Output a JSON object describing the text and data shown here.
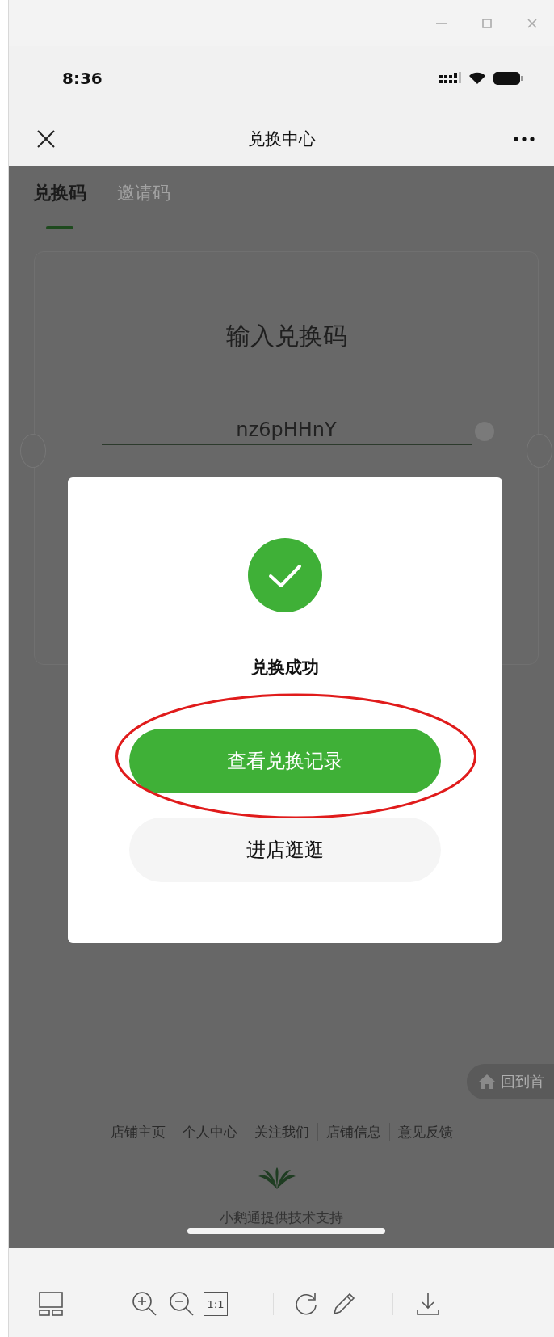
{
  "status_bar": {
    "time": "8:36"
  },
  "nav": {
    "title": "兑换中心"
  },
  "tabs": [
    {
      "label": "兑换码",
      "selected": true
    },
    {
      "label": "邀请码",
      "selected": false
    }
  ],
  "card": {
    "title": "输入兑换码",
    "code": "nz6pHHnY"
  },
  "dialog": {
    "message": "兑换成功",
    "buttons": [
      {
        "label": "查看兑换记录",
        "kind": "primary",
        "highlighted": true
      },
      {
        "label": "进店逛逛",
        "kind": "secondary",
        "highlighted": false
      }
    ]
  },
  "home_button": {
    "label": "回到首"
  },
  "footer_links": [
    "店铺主页",
    "个人中心",
    "关注我们",
    "店铺信息",
    "意见反馈"
  ],
  "credit": "小鹅通提供技术支持",
  "toolbar": {
    "actual_size_label": "1:1"
  }
}
